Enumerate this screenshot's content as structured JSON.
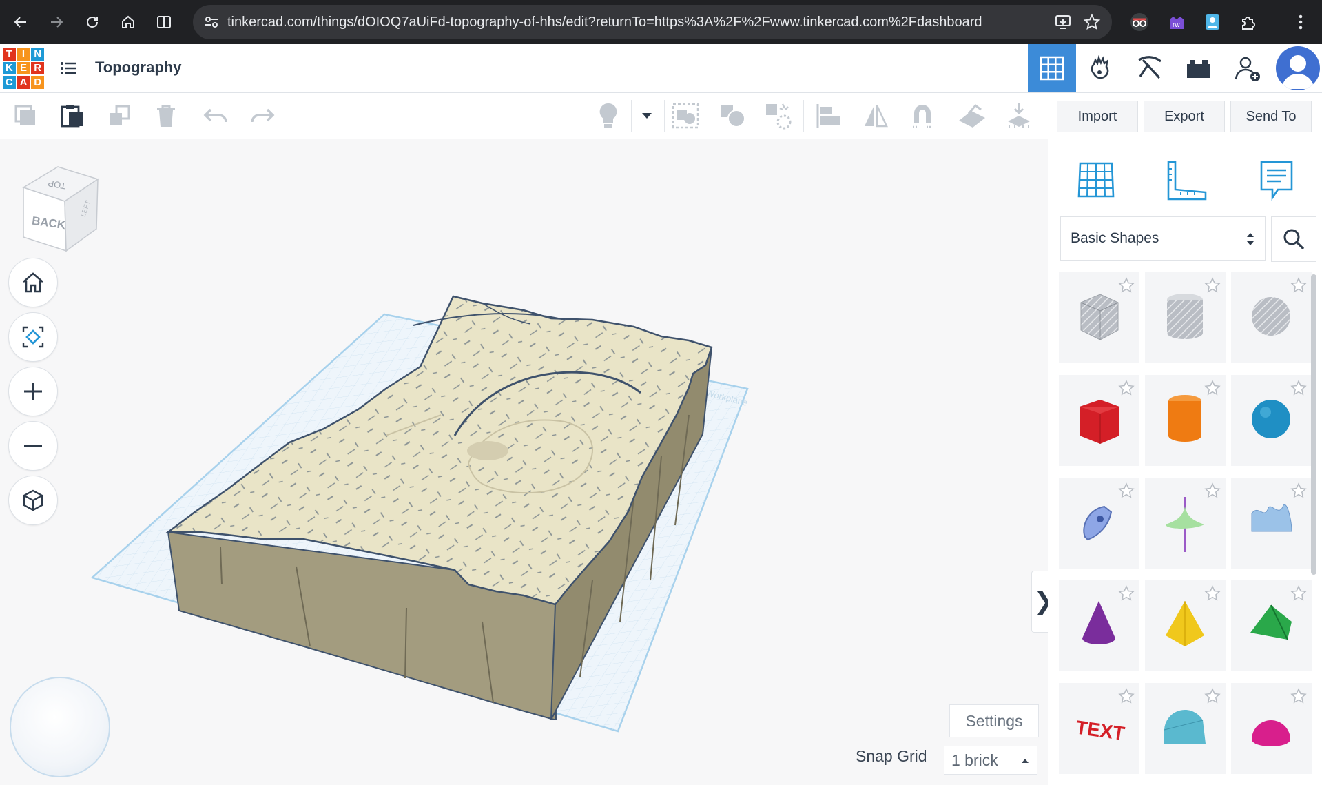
{
  "browser": {
    "url": "tinkercad.com/things/dOIOQ7aUiFd-topography-of-hhs/edit?returnTo=https%3A%2F%2Fwww.tinkercad.com%2Fdashboard"
  },
  "app": {
    "logo_letters": [
      "T",
      "I",
      "N",
      "K",
      "E",
      "R",
      "C",
      "A",
      "D"
    ],
    "logo_colors": [
      "#e1341e",
      "#f7941d",
      "#1e9ad6",
      "#1e9ad6",
      "#f7941d",
      "#e1341e",
      "#1e9ad6",
      "#e1341e",
      "#f7941d"
    ],
    "title": "Topography",
    "accent": "#3c8bd8"
  },
  "toolbar": {
    "import_label": "Import",
    "export_label": "Export",
    "send_to_label": "Send To"
  },
  "workspace": {
    "viewcube": {
      "top_face": "TOP",
      "front_face": "BACK",
      "side_face": "LEFT"
    },
    "workplane_label": "Workplane",
    "settings_label": "Settings",
    "snap_grid_label": "Snap Grid",
    "snap_grid_value": "1 brick",
    "model_color": "#e9e4c7",
    "model_side_color": "#a39c7f"
  },
  "panel": {
    "category": "Basic Shapes",
    "shapes": [
      {
        "name": "Box (hole)",
        "color": "#b9bdc4"
      },
      {
        "name": "Cylinder (hole)",
        "color": "#b9bdc4"
      },
      {
        "name": "Sphere (hole)",
        "color": "#b9bdc4"
      },
      {
        "name": "Box",
        "color": "#d41f27"
      },
      {
        "name": "Cylinder",
        "color": "#ef7b12"
      },
      {
        "name": "Sphere",
        "color": "#1f8fc4"
      },
      {
        "name": "Scribble",
        "color": "#8ea6e6"
      },
      {
        "name": "Shape Generator",
        "color": "#a6e0a0"
      },
      {
        "name": "Text and Numbers",
        "color": "#9bc2e8"
      },
      {
        "name": "Cone",
        "color": "#7a2d9c"
      },
      {
        "name": "Pyramid",
        "color": "#f0c81c"
      },
      {
        "name": "Roof",
        "color": "#2aa84a"
      },
      {
        "name": "Text",
        "color": "#d41f27"
      },
      {
        "name": "Round Roof",
        "color": "#5ab9cf"
      },
      {
        "name": "Half Sphere",
        "color": "#d81f8c"
      }
    ],
    "text_shape_label": "TEXT"
  }
}
